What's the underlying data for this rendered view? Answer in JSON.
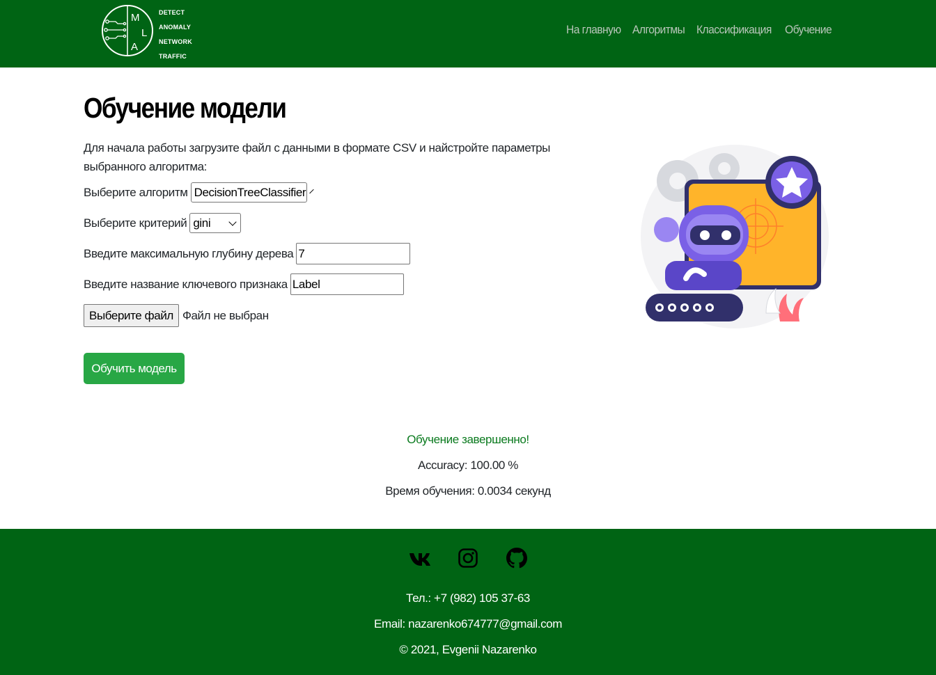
{
  "header": {
    "logo_letters": [
      "M",
      "L",
      "A"
    ],
    "logo_words": [
      "DETECT",
      "ANOMALY",
      "NETWORK",
      "TRAFFIC"
    ],
    "nav": [
      "На главную",
      "Алгоритмы",
      "Классификация",
      "Обучение"
    ]
  },
  "main": {
    "title": "Обучение модели",
    "intro": "Для начала работы загрузите файл с данными в формате CSV и найстройте параметры выбранного алгоритма:",
    "algorithm": {
      "label": "Выберите алгоритм",
      "value": "DecisionTreeClassifier"
    },
    "criterion": {
      "label": "Выберите критерий",
      "value": "gini"
    },
    "max_depth": {
      "label": "Введите максимальную глубину дерева",
      "value": "7"
    },
    "key_feature": {
      "label": "Введите название ключевого признака",
      "value": "Label"
    },
    "file": {
      "button": "Выберите файл",
      "status": "Файл не выбран"
    },
    "train_button": "Обучить модель"
  },
  "result": {
    "status": "Обучение завершенно!",
    "accuracy": "Accuracy: 100.00 %",
    "time": "Время обучения: 0.0034 секунд"
  },
  "footer": {
    "social_icons": [
      "vk-icon",
      "instagram-icon",
      "github-icon"
    ],
    "phone": "Тел.: +7 (982) 105 37-63",
    "email": "Email: nazarenko674777@gmail.com",
    "copyright": "© 2021, Evgenii Nazarenko"
  },
  "colors": {
    "header_bg": "#006414",
    "nav_link": "#b8c6ba",
    "button_green": "#28a745",
    "status_green": "#0a7a1e"
  }
}
